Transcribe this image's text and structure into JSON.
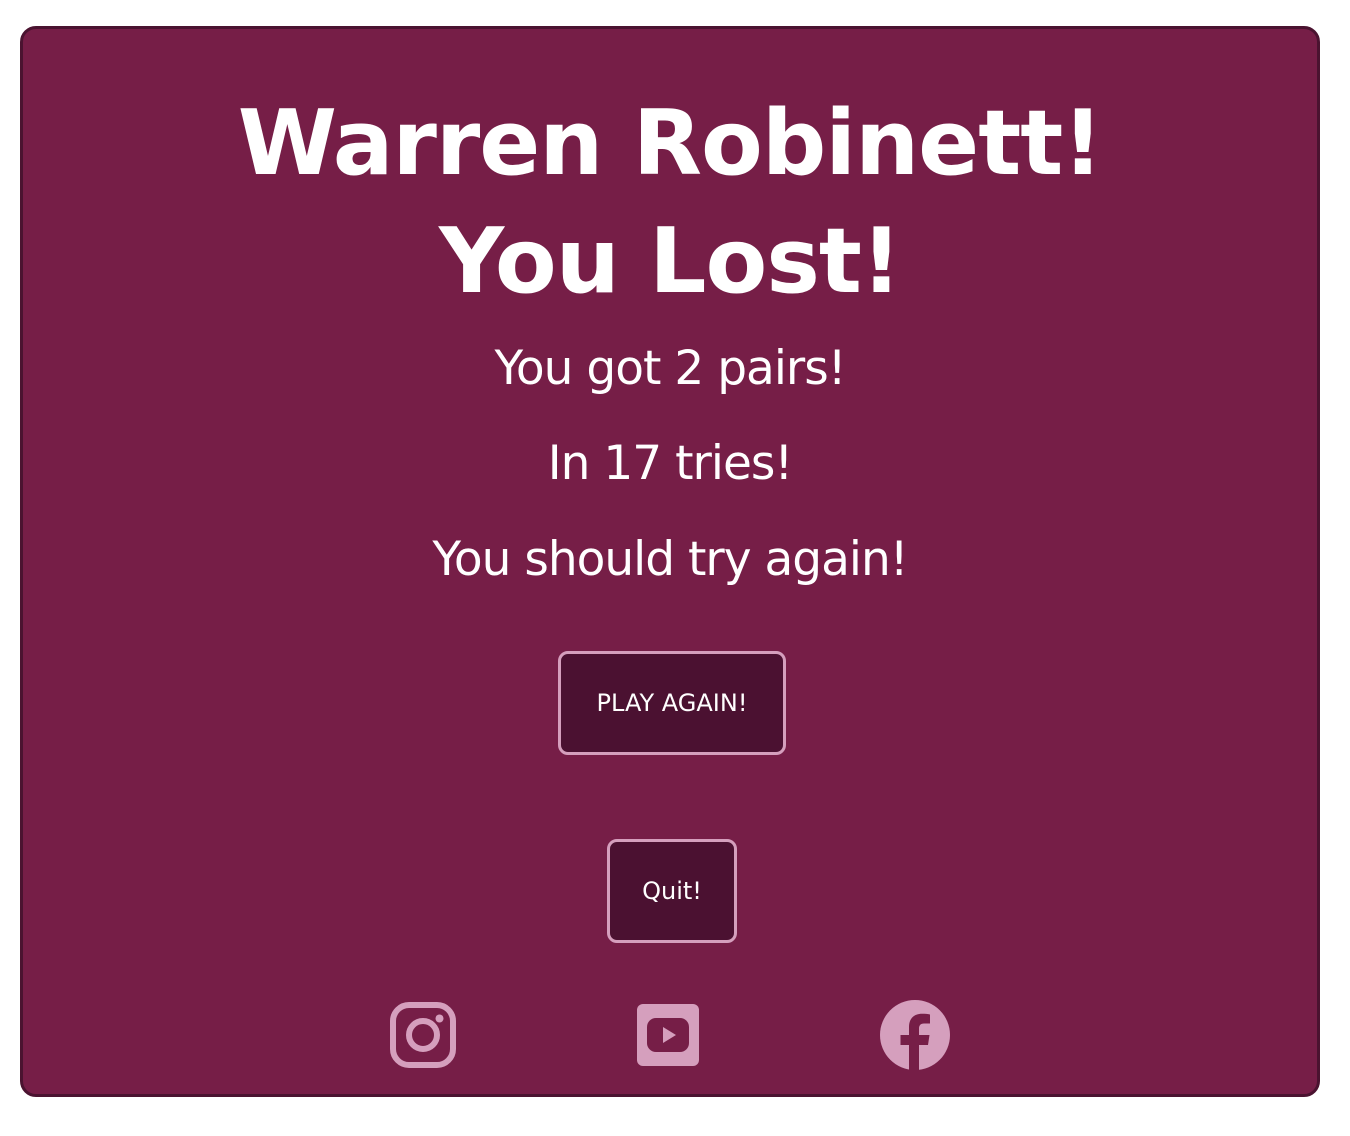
{
  "game_over": {
    "title": "Warren Robinett! You Lost!",
    "pairs_text": "You got 2 pairs!",
    "tries_text": "In 17 tries!",
    "message": "You should try again!",
    "play_again_label": "PLAY AGAIN!",
    "quit_label": "Quit!"
  },
  "social": {
    "icons": [
      "instagram-icon",
      "youtube-icon",
      "facebook-icon"
    ],
    "icon_color": "#d59fbd"
  },
  "colors": {
    "card_background": "#761e47",
    "card_border": "#4a1330",
    "button_background": "#4b1131",
    "button_border": "#d59fbd",
    "text": "#ffffff"
  }
}
